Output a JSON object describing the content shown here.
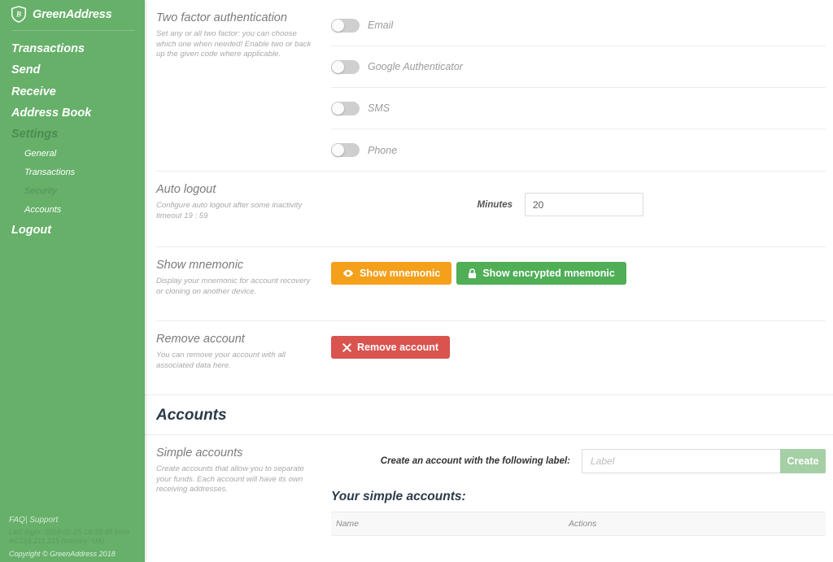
{
  "brand": {
    "name": "GreenAddress",
    "logo_icon": "shield-bitcoin-icon"
  },
  "sidebar": {
    "nav": [
      {
        "label": "Transactions",
        "active": false
      },
      {
        "label": "Send",
        "active": false
      },
      {
        "label": "Receive",
        "active": false
      },
      {
        "label": "Address Book",
        "active": false
      },
      {
        "label": "Settings",
        "active": true
      }
    ],
    "sub_nav": [
      {
        "label": "General",
        "active": false
      },
      {
        "label": "Transactions",
        "active": false
      },
      {
        "label": "Security",
        "active": true
      },
      {
        "label": "Accounts",
        "active": false
      }
    ],
    "logout": "Logout",
    "footer": {
      "faq": "FAQ",
      "separator": "|",
      "support": "Support",
      "last_login": "Last login: 2018-02-25 19:39:48 from 46.219.211.215 (country: UA)",
      "copyright": "Copyright © GreenAddress 2018"
    }
  },
  "two_factor": {
    "title": "Two factor authentication",
    "description": "Set any or all two factor: you can choose which one when needed! Enable two or back up the given code where applicable.",
    "methods": [
      {
        "label": "Email",
        "enabled": false
      },
      {
        "label": "Google Authenticator",
        "enabled": false
      },
      {
        "label": "SMS",
        "enabled": false
      },
      {
        "label": "Phone",
        "enabled": false
      }
    ]
  },
  "auto_logout": {
    "title": "Auto logout",
    "description": "Configure auto logout after some inactivity timeout 19 : 59",
    "minutes_label": "Minutes",
    "minutes_value": "20",
    "minutes_placeholder": "Minutes"
  },
  "show_mnemonic": {
    "title": "Show mnemonic",
    "description": "Display your mnemonic for account recovery or cloning on another device.",
    "show_button": "Show mnemonic",
    "show_button_icon": "eye-icon",
    "show_button_color": "#f5a01b",
    "encrypted_button": "Show encrypted mnemonic",
    "encrypted_button_icon": "lock-icon",
    "encrypted_button_color": "#4fae56"
  },
  "remove_account": {
    "title": "Remove account",
    "description": "You can remove your account with all associated data here.",
    "button": "Remove account",
    "button_icon": "times-icon",
    "button_color": "#d9534f"
  },
  "accounts": {
    "heading": "Accounts",
    "simple": {
      "title": "Simple accounts",
      "description": "Create accounts that allow you to separate your funds. Each account will have its own receiving addresses.",
      "create_label": "Create an account with the following label:",
      "input_value": "",
      "input_placeholder": "Label",
      "create_button": "Create",
      "create_button_color": "#a5cfa5"
    },
    "list": {
      "title": "Your simple accounts:",
      "columns": [
        "Name",
        "Actions"
      ],
      "rows": []
    }
  },
  "colors": {
    "sidebar_green": "#66b069",
    "divider": "#ececec",
    "heading_navy": "#2b3a4a"
  }
}
